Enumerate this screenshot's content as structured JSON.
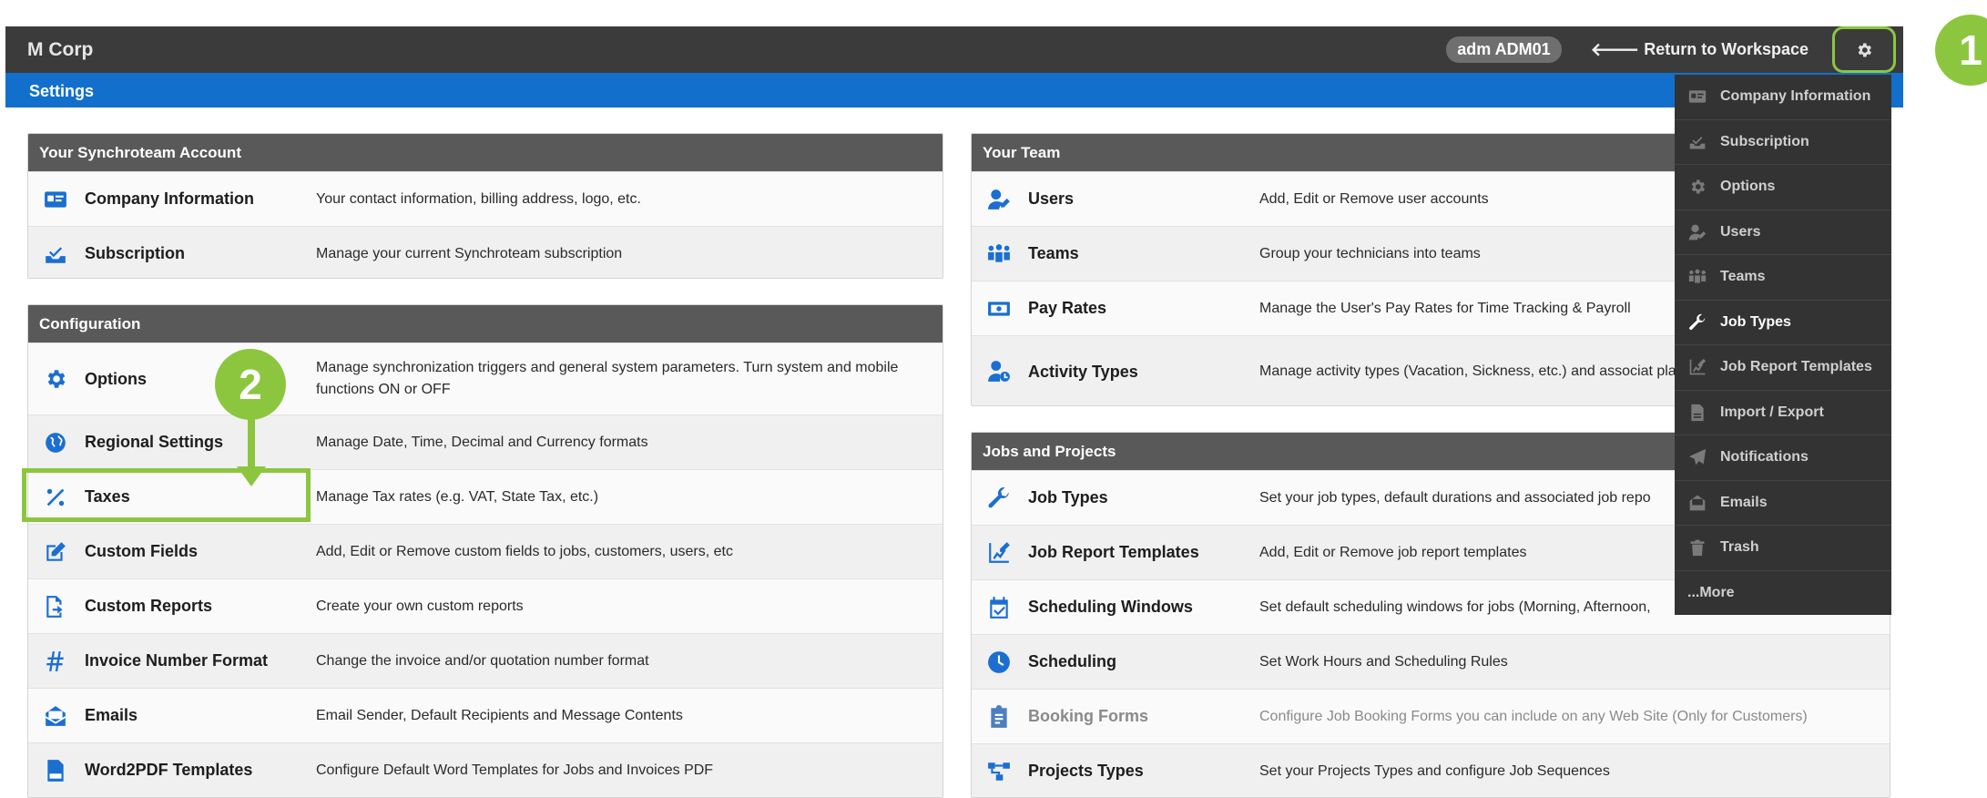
{
  "header": {
    "brand": "M Corp",
    "user_badge": "adm ADM01",
    "return_label": "Return to Workspace",
    "return_arrow": "🡐",
    "settings_icon": "gear-icon"
  },
  "subheader": {
    "title": "Settings"
  },
  "panels": {
    "account": {
      "title": "Your Synchroteam Account",
      "rows": [
        {
          "icon": "id-card-icon",
          "name": "Company Information",
          "desc": "Your contact information, billing address, logo, etc."
        },
        {
          "icon": "subscription-icon",
          "name": "Subscription",
          "desc": "Manage your current Synchroteam subscription"
        }
      ]
    },
    "configuration": {
      "title": "Configuration",
      "rows": [
        {
          "icon": "gear-icon",
          "name": "Options",
          "desc": "Manage synchronization triggers and general system parameters. Turn system and mobile functions ON or OFF"
        },
        {
          "icon": "globe-icon",
          "name": "Regional Settings",
          "desc": "Manage Date, Time, Decimal and Currency formats"
        },
        {
          "icon": "percent-icon",
          "name": "Taxes",
          "desc": "Manage Tax rates (e.g. VAT, State Tax, etc.)"
        },
        {
          "icon": "edit-icon",
          "name": "Custom Fields",
          "desc": "Add, Edit or Remove custom fields to jobs, customers, users, etc"
        },
        {
          "icon": "report-export-icon",
          "name": "Custom Reports",
          "desc": "Create your own custom reports"
        },
        {
          "icon": "hashtag-icon",
          "name": "Invoice Number Format",
          "desc": "Change the invoice and/or quotation number format"
        },
        {
          "icon": "email-icon",
          "name": "Emails",
          "desc": "Email Sender, Default Recipients and Message Contents"
        },
        {
          "icon": "pdf-file-icon",
          "name": "Word2PDF Templates",
          "desc": "Configure Default Word Templates for Jobs and Invoices PDF"
        }
      ]
    },
    "team": {
      "title": "Your Team",
      "rows": [
        {
          "icon": "user-edit-icon",
          "name": "Users",
          "desc": "Add, Edit or Remove user accounts"
        },
        {
          "icon": "team-icon",
          "name": "Teams",
          "desc": "Group your technicians into teams"
        },
        {
          "icon": "money-icon",
          "name": "Pay Rates",
          "desc": "Manage the User's Pay Rates for Time Tracking & Payroll"
        },
        {
          "icon": "user-clock-icon",
          "name": "Activity Types",
          "desc": "Manage activity types (Vacation, Sickness, etc.) and associat planning view"
        }
      ]
    },
    "jobs": {
      "title": "Jobs and Projects",
      "rows": [
        {
          "icon": "wrench-icon",
          "name": "Job Types",
          "desc": "Set your job types, default durations and associated job repo"
        },
        {
          "icon": "report-template-icon",
          "name": "Job Report Templates",
          "desc": "Add, Edit or Remove job report templates"
        },
        {
          "icon": "calendar-check-icon",
          "name": "Scheduling Windows",
          "desc": "Set default scheduling windows for jobs (Morning, Afternoon,"
        },
        {
          "icon": "clock-icon",
          "name": "Scheduling",
          "desc": "Set Work Hours and Scheduling Rules"
        },
        {
          "icon": "clipboard-icon",
          "name": "Booking Forms",
          "desc": "Configure Job Booking Forms you can include on any Web Site (Only for Customers)",
          "disabled": true
        },
        {
          "icon": "project-flow-icon",
          "name": "Projects Types",
          "desc": "Set your Projects Types and configure Job Sequences"
        }
      ]
    }
  },
  "dropdown": {
    "items": [
      {
        "icon": "id-card-icon",
        "label": "Company Information"
      },
      {
        "icon": "subscription-icon",
        "label": "Subscription"
      },
      {
        "icon": "gear-icon",
        "label": "Options"
      },
      {
        "icon": "user-edit-icon",
        "label": "Users"
      },
      {
        "icon": "team-icon",
        "label": "Teams"
      },
      {
        "icon": "wrench-icon",
        "label": "Job Types",
        "active": true
      },
      {
        "icon": "report-template-icon",
        "label": "Job Report Templates"
      },
      {
        "icon": "import-export-icon",
        "label": "Import / Export"
      },
      {
        "icon": "paper-plane-icon",
        "label": "Notifications"
      },
      {
        "icon": "email-icon",
        "label": "Emails"
      },
      {
        "icon": "trash-icon",
        "label": "Trash"
      }
    ],
    "more_label": "...More"
  },
  "callouts": {
    "one": "1",
    "two": "2"
  },
  "colors": {
    "accent": "#8cc63f",
    "blue_bar": "#1270cc",
    "topbar": "#3b3b3b",
    "icon_blue": "#1a6fd1"
  }
}
